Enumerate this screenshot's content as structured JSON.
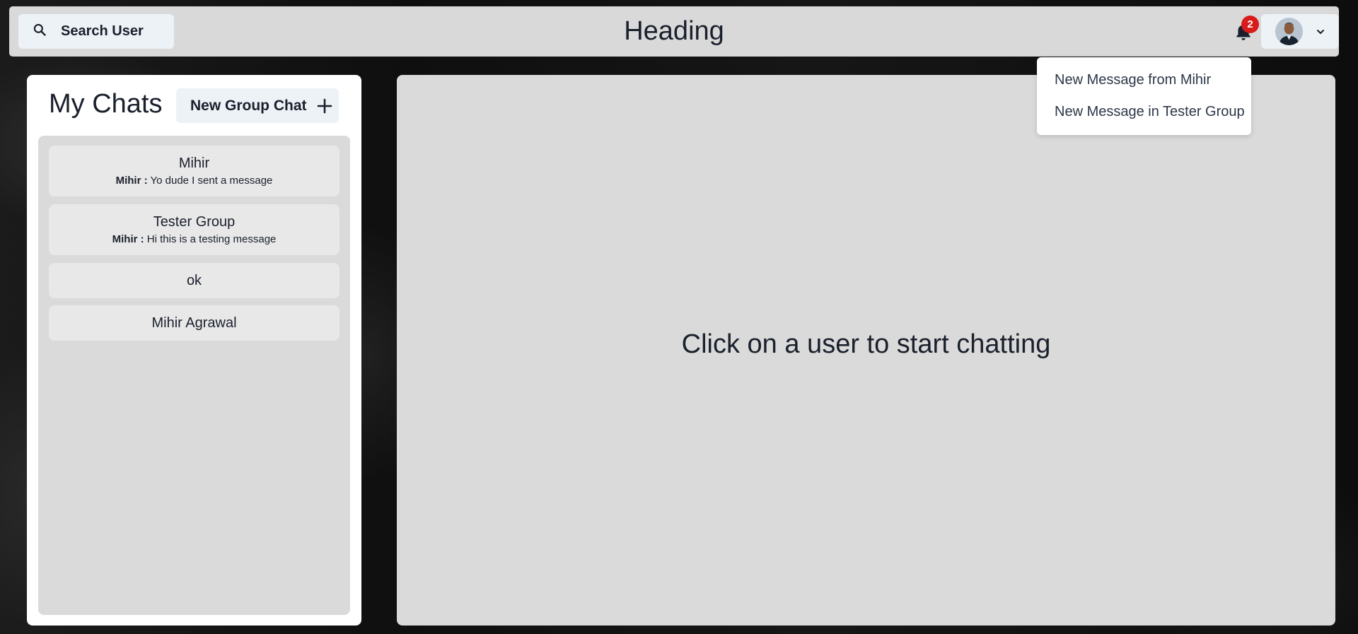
{
  "header": {
    "search_label": "Search User",
    "title": "Heading",
    "notification_count": "2",
    "icons": {
      "search": "search-icon",
      "bell": "bell-icon",
      "profile_menu": "chevron-down-icon"
    }
  },
  "notifications": {
    "items": [
      {
        "label": "New Message from Mihir"
      },
      {
        "label": "New Message in Tester Group"
      }
    ]
  },
  "chats": {
    "title": "My Chats",
    "new_group_label": "New Group Chat",
    "items": [
      {
        "name": "Mihir",
        "sender": "Mihir :",
        "preview": "Yo dude I sent a message"
      },
      {
        "name": "Tester Group",
        "sender": "Mihir :",
        "preview": "Hi this is a testing message"
      },
      {
        "name": "ok"
      },
      {
        "name": "Mihir Agrawal"
      }
    ]
  },
  "main": {
    "empty_message": "Click on a user to start chatting"
  },
  "colors": {
    "topbar_bg": "#d9d9d9",
    "button_bg": "#edf2f7",
    "badge": "#d81b1b",
    "panel_bg": "#dadada",
    "chat_item_bg": "#e8e8e8"
  }
}
